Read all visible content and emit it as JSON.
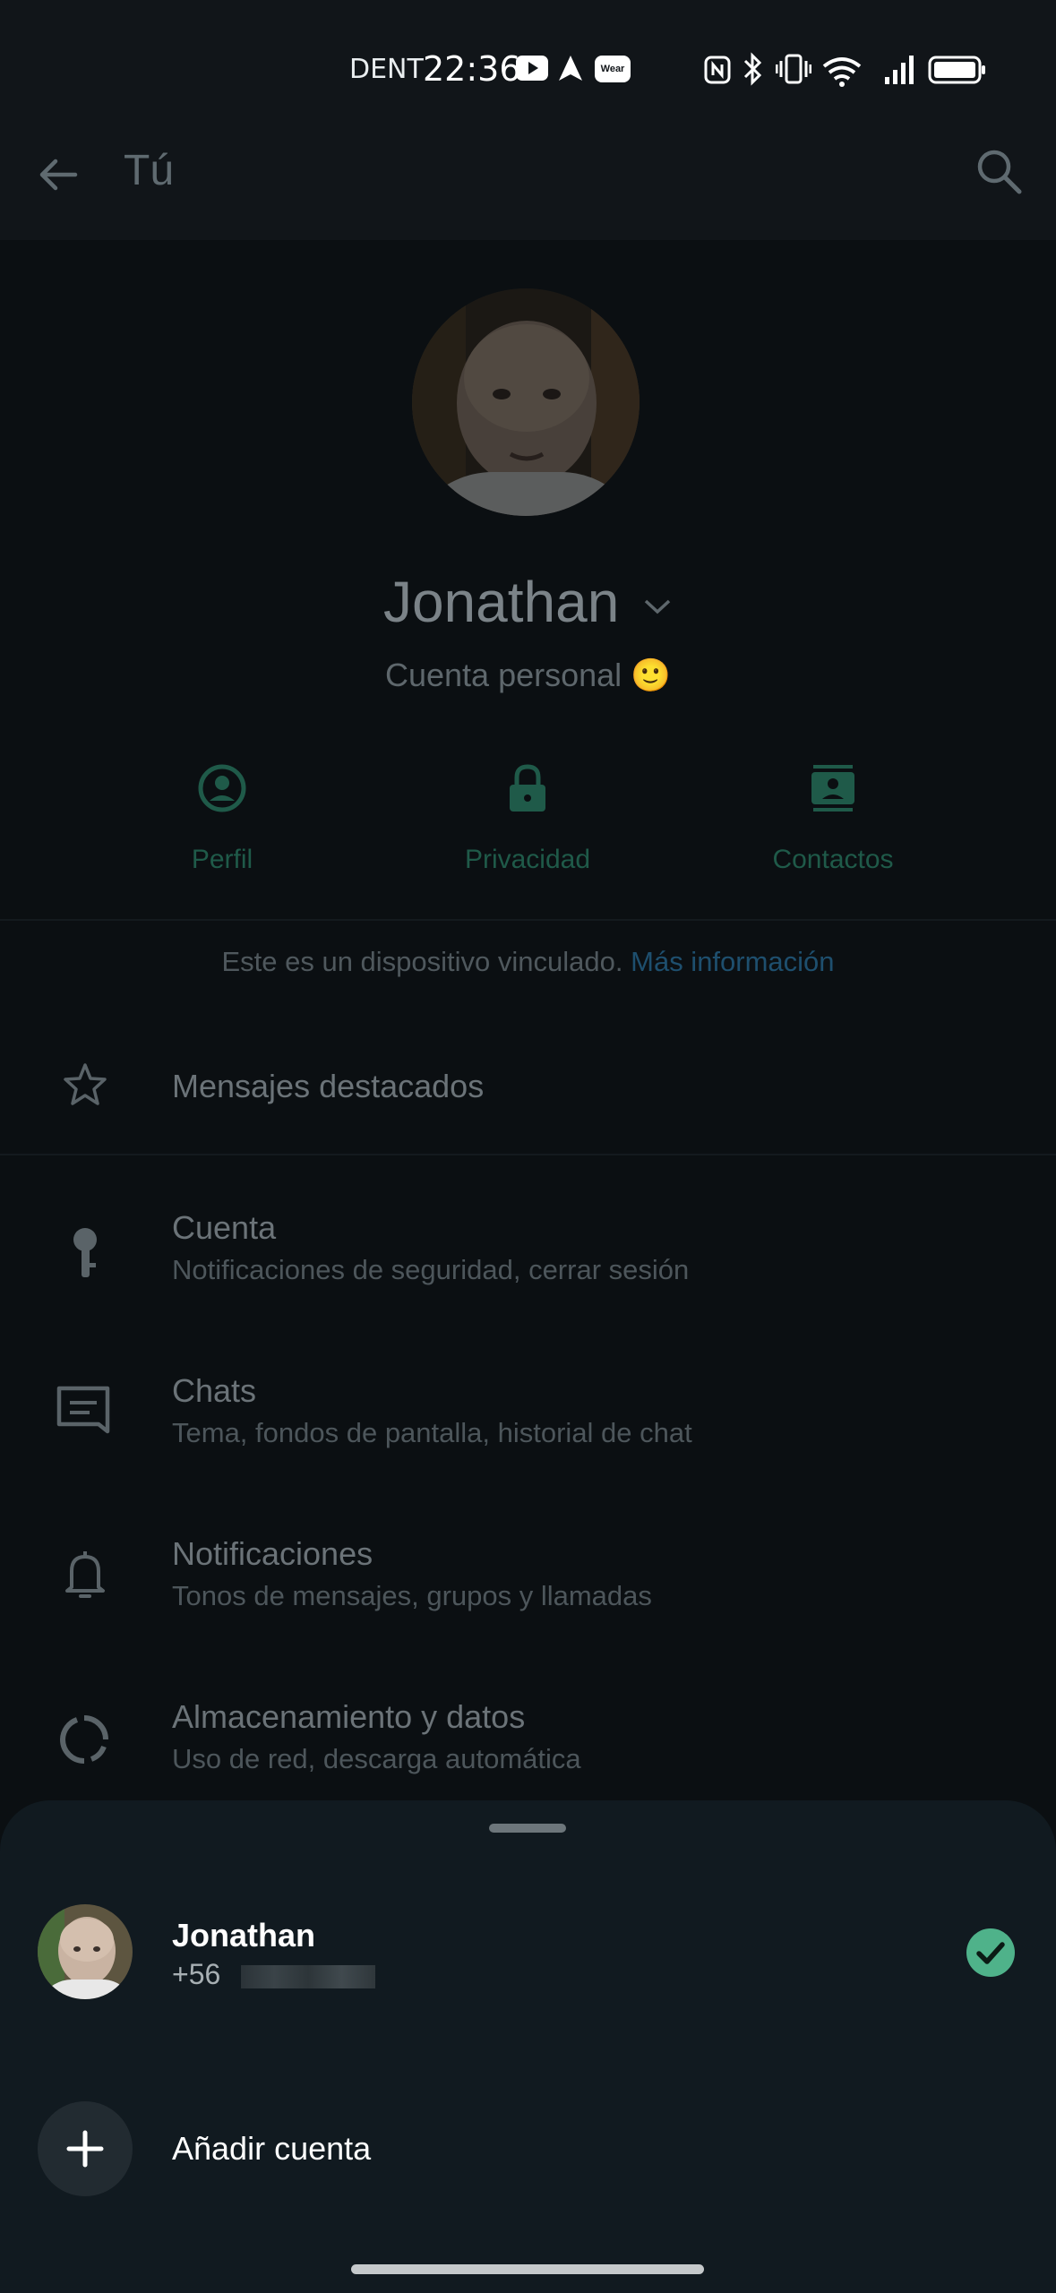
{
  "status_bar": {
    "carrier": "DENT",
    "time": "22:36",
    "wear_badge": "Wear"
  },
  "header": {
    "title": "Tú"
  },
  "profile": {
    "name": "Jonathan",
    "subtitle": "Cuenta personal 🙂"
  },
  "actions": [
    {
      "label": "Perfil",
      "icon": "profile-icon"
    },
    {
      "label": "Privacidad",
      "icon": "lock-icon"
    },
    {
      "label": "Contactos",
      "icon": "contacts-icon"
    }
  ],
  "linked_notice": {
    "text": "Este es un dispositivo vinculado.",
    "link": "Más información"
  },
  "menu": [
    {
      "title": "Mensajes destacados",
      "subtitle": "",
      "icon": "star-icon"
    },
    {
      "title": "Cuenta",
      "subtitle": "Notificaciones de seguridad, cerrar sesión",
      "icon": "key-icon"
    },
    {
      "title": "Chats",
      "subtitle": "Tema, fondos de pantalla, historial de chat",
      "icon": "chat-icon"
    },
    {
      "title": "Notificaciones",
      "subtitle": "Tonos de mensajes, grupos y llamadas",
      "icon": "bell-icon"
    },
    {
      "title": "Almacenamiento y datos",
      "subtitle": "Uso de red, descarga automática",
      "icon": "storage-icon"
    }
  ],
  "account_sheet": {
    "account_name": "Jonathan",
    "account_phone": "+56",
    "add_account_label": "Añadir cuenta"
  },
  "colors": {
    "accent_green": "#21c063",
    "link_blue": "#53bdeb",
    "sheet_bg": "#111a20"
  }
}
